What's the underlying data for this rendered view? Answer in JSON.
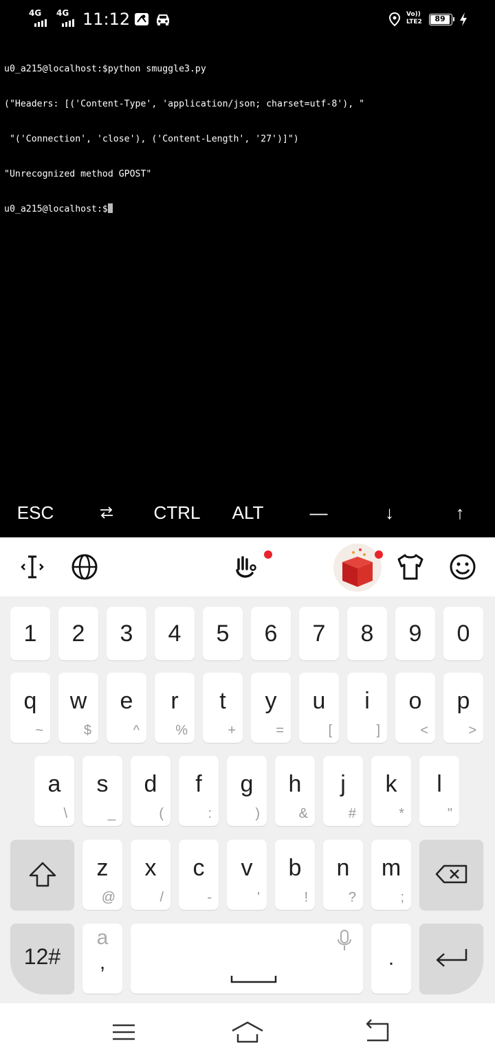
{
  "status_bar": {
    "network1": "4G",
    "network2": "4G",
    "time": "11:12",
    "volte_top": "Vo))",
    "volte_bottom": "LTE2",
    "battery": "89"
  },
  "terminal": {
    "lines": [
      "u0_a215@localhost:$python smuggle3.py",
      "(\"Headers: [('Content-Type', 'application/json; charset=utf-8'), \"",
      " \"('Connection', 'close'), ('Content-Length', '27')]\")",
      "\"Unrecognized method GPOST\"",
      "u0_a215@localhost:$"
    ]
  },
  "extra_keys": {
    "esc": "ESC",
    "tab": "⭾",
    "ctrl": "CTRL",
    "alt": "ALT",
    "dash": "—",
    "down": "↓",
    "up": "↑"
  },
  "keyboard": {
    "number_row": [
      "1",
      "2",
      "3",
      "4",
      "5",
      "6",
      "7",
      "8",
      "9",
      "0"
    ],
    "row1": [
      {
        "main": "q",
        "sub": "~"
      },
      {
        "main": "w",
        "sub": "$"
      },
      {
        "main": "e",
        "sub": "^"
      },
      {
        "main": "r",
        "sub": "%"
      },
      {
        "main": "t",
        "sub": "+"
      },
      {
        "main": "y",
        "sub": "="
      },
      {
        "main": "u",
        "sub": "["
      },
      {
        "main": "i",
        "sub": "]"
      },
      {
        "main": "o",
        "sub": "<"
      },
      {
        "main": "p",
        "sub": ">"
      }
    ],
    "row2": [
      {
        "main": "a",
        "sub": "\\"
      },
      {
        "main": "s",
        "sub": "_"
      },
      {
        "main": "d",
        "sub": "("
      },
      {
        "main": "f",
        "sub": ":"
      },
      {
        "main": "g",
        "sub": ")"
      },
      {
        "main": "h",
        "sub": "&"
      },
      {
        "main": "j",
        "sub": "#"
      },
      {
        "main": "k",
        "sub": "*"
      },
      {
        "main": "l",
        "sub": "\""
      }
    ],
    "row3": [
      {
        "main": "z",
        "sub": "@"
      },
      {
        "main": "x",
        "sub": "/"
      },
      {
        "main": "c",
        "sub": "-"
      },
      {
        "main": "v",
        "sub": "'"
      },
      {
        "main": "b",
        "sub": "!"
      },
      {
        "main": "n",
        "sub": "?"
      },
      {
        "main": "m",
        "sub": ";"
      }
    ],
    "symbols_key": "12#",
    "comma_key_top": "a",
    "comma_key_bottom": ",",
    "period_key": ".",
    "icons": {
      "cursor": "text-cursor-icon",
      "language": "globe-icon",
      "gesture": "gesture-hand-icon",
      "gift": "gift-box-icon",
      "theme": "tshirt-icon",
      "emoji": "emoji-icon",
      "shift": "shift-arrow-icon",
      "backspace": "backspace-icon",
      "mic": "microphone-icon",
      "enter": "enter-arrow-icon"
    },
    "colors": {
      "accent_red": "#e8242c",
      "key_bg": "#ffffff",
      "dark_key_bg": "#d9d9d9",
      "keyboard_bg": "#f0f0f0"
    }
  },
  "nav_bar": {
    "icons": [
      "menu-icon",
      "home-icon",
      "back-icon"
    ]
  }
}
